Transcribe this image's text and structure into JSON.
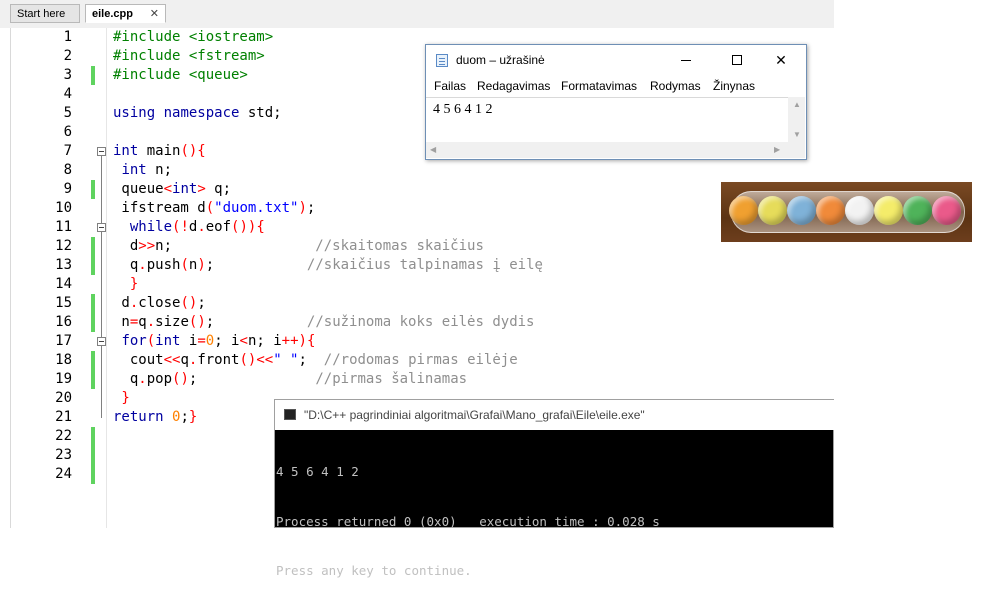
{
  "ide": {
    "tabs": [
      {
        "label": "Start here"
      },
      {
        "label": "eile.cpp"
      }
    ],
    "close_glyph": "✕",
    "line_numbers": [
      "1",
      "2",
      "3",
      "4",
      "5",
      "6",
      "7",
      "8",
      "9",
      "10",
      "11",
      "12",
      "13",
      "14",
      "15",
      "16",
      "17",
      "18",
      "19",
      "20",
      "21",
      "22",
      "23",
      "24"
    ],
    "lines": [
      [
        [
          "pp",
          "#include <iostream>"
        ]
      ],
      [
        [
          "pp",
          "#include <fstream>"
        ]
      ],
      [
        [
          "pp",
          "#include <queue>"
        ]
      ],
      [],
      [
        [
          "kw",
          "using"
        ],
        [
          "tx",
          " "
        ],
        [
          "kw",
          "namespace"
        ],
        [
          "tx",
          " std;"
        ]
      ],
      [],
      [
        [
          "kw",
          "int"
        ],
        [
          "tx",
          " main"
        ],
        [
          "op",
          "(){"
        ]
      ],
      [
        [
          "tx",
          " "
        ],
        [
          "kw",
          "int"
        ],
        [
          "tx",
          " n;"
        ]
      ],
      [
        [
          "tx",
          " queue"
        ],
        [
          "op",
          "<"
        ],
        [
          "kw",
          "int"
        ],
        [
          "op",
          ">"
        ],
        [
          "tx",
          " q;"
        ]
      ],
      [
        [
          "tx",
          " ifstream d"
        ],
        [
          "op",
          "("
        ],
        [
          "st",
          "\"duom.txt\""
        ],
        [
          "op",
          ")"
        ],
        [
          "tx",
          ";"
        ]
      ],
      [
        [
          "tx",
          "  "
        ],
        [
          "kw",
          "while"
        ],
        [
          "op",
          "(!"
        ],
        [
          "tx",
          "d"
        ],
        [
          "op",
          "."
        ],
        [
          "tx",
          "eof"
        ],
        [
          "op",
          "()){"
        ]
      ],
      [
        [
          "tx",
          "  d"
        ],
        [
          "op",
          ">>"
        ],
        [
          "tx",
          "n;"
        ],
        [
          "cm",
          "                 //skaitomas skaičius"
        ]
      ],
      [
        [
          "tx",
          "  q"
        ],
        [
          "op",
          "."
        ],
        [
          "tx",
          "push"
        ],
        [
          "op",
          "("
        ],
        [
          "tx",
          "n"
        ],
        [
          "op",
          ")"
        ],
        [
          "tx",
          ";"
        ],
        [
          "cm",
          "           //skaičius talpinamas į eilę"
        ]
      ],
      [
        [
          "op",
          "  }"
        ]
      ],
      [
        [
          "tx",
          " d"
        ],
        [
          "op",
          "."
        ],
        [
          "tx",
          "close"
        ],
        [
          "op",
          "()"
        ],
        [
          "tx",
          ";"
        ]
      ],
      [
        [
          "tx",
          " n"
        ],
        [
          "op",
          "="
        ],
        [
          "tx",
          "q"
        ],
        [
          "op",
          "."
        ],
        [
          "tx",
          "size"
        ],
        [
          "op",
          "()"
        ],
        [
          "tx",
          ";"
        ],
        [
          "cm",
          "           //sužinoma koks eilės dydis"
        ]
      ],
      [
        [
          "tx",
          " "
        ],
        [
          "kw",
          "for"
        ],
        [
          "op",
          "("
        ],
        [
          "kw",
          "int"
        ],
        [
          "tx",
          " i"
        ],
        [
          "op",
          "="
        ],
        [
          "nm",
          "0"
        ],
        [
          "tx",
          "; i"
        ],
        [
          "op",
          "<"
        ],
        [
          "tx",
          "n; i"
        ],
        [
          "op",
          "++){"
        ]
      ],
      [
        [
          "tx",
          "  cout"
        ],
        [
          "op",
          "<<"
        ],
        [
          "tx",
          "q"
        ],
        [
          "op",
          "."
        ],
        [
          "tx",
          "front"
        ],
        [
          "op",
          "()<<"
        ],
        [
          "st",
          "\" \""
        ],
        [
          "tx",
          ";"
        ],
        [
          "cm",
          "  //rodomas pirmas eilėje"
        ]
      ],
      [
        [
          "tx",
          "  q"
        ],
        [
          "op",
          "."
        ],
        [
          "tx",
          "pop"
        ],
        [
          "op",
          "()"
        ],
        [
          "tx",
          ";"
        ],
        [
          "cm",
          "              //pirmas šalinamas"
        ]
      ],
      [
        [
          "op",
          " }"
        ]
      ],
      [
        [
          "kw",
          "return"
        ],
        [
          "tx",
          " "
        ],
        [
          "nm",
          "0"
        ],
        [
          "tx",
          ";"
        ],
        [
          "op",
          "}"
        ]
      ],
      [],
      [],
      []
    ],
    "changed_lines": [
      3,
      9,
      12,
      13,
      15,
      16,
      18,
      19,
      22,
      23,
      24
    ]
  },
  "notepad": {
    "title": "duom – užrašinė",
    "menu": [
      "Failas",
      "Redagavimas",
      "Formatavimas",
      "Rodymas",
      "Žinynas"
    ],
    "content": "4 5 6 4 1 2",
    "minimize_label": "",
    "maximize_label": "",
    "close_label": "✕",
    "icon": "notepad-icon"
  },
  "photo": {
    "ball_colors": [
      "#f0a030",
      "#e6dc5a",
      "#7fb2d8",
      "#f08a3a",
      "#f2f2f2",
      "#f4ec6a",
      "#4fb35a",
      "#ea5a8a"
    ]
  },
  "console": {
    "title": "\"D:\\C++ pagrindiniai algoritmai\\Grafai\\Mano_grafai\\Eile\\eile.exe\"",
    "lines": [
      "4 5 6 4 1 2",
      "Process returned 0 (0x0)   execution time : 0.028 s",
      "Press any key to continue."
    ]
  }
}
